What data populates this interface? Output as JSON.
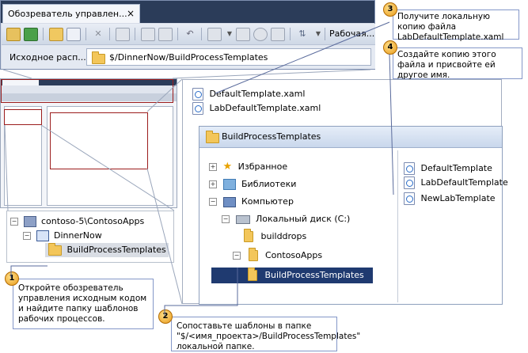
{
  "explorer": {
    "tab_title": "Обозреватель управлен...",
    "tab_close": "×",
    "toolbar_right_label": "Рабочая...",
    "path_label": "Исходное расп...",
    "path_value": "$/DinnerNow/BuildProcessTemplates"
  },
  "left_tree": {
    "items": [
      {
        "label": "contoso-5\\ContosoApps"
      },
      {
        "label": "DinnerNow"
      },
      {
        "label": "BuildProcessTemplates"
      }
    ]
  },
  "files_top": [
    {
      "label": "DefaultTemplate.xaml"
    },
    {
      "label": "LabDefaultTemplate.xaml"
    }
  ],
  "local_window": {
    "title": "BuildProcessTemplates",
    "tree": [
      {
        "label": "Избранное"
      },
      {
        "label": "Библиотеки"
      },
      {
        "label": "Компьютер"
      },
      {
        "label": "Локальный диск (C:)"
      },
      {
        "label": "builddrops"
      },
      {
        "label": "ContosoApps"
      },
      {
        "label": "BuildProcessTemplates"
      }
    ],
    "files": [
      {
        "label": "DefaultTemplate"
      },
      {
        "label": "LabDefaultTemplate"
      },
      {
        "label": "NewLabTemplate"
      }
    ]
  },
  "callouts": [
    {
      "number": "1",
      "text": "Откройте обозреватель управления исходным кодом и найдите папку шаблонов рабочих процессов."
    },
    {
      "number": "2",
      "text": "Сопоставьте шаблоны в папке \"$/<имя_проекта>/BuildProcessTemplates\" локальной папке."
    },
    {
      "number": "3",
      "text": "Получите локальную копию файла LabDefaultTemplate.xaml"
    },
    {
      "number": "4",
      "text": "Создайте копию этого файла и присвойте ей другое имя."
    }
  ],
  "colors": {
    "accent_dark": "#2b3c59",
    "selection": "#1f3a70",
    "callout_border": "#8497c8",
    "highlight_red": "#9b1c1c"
  }
}
